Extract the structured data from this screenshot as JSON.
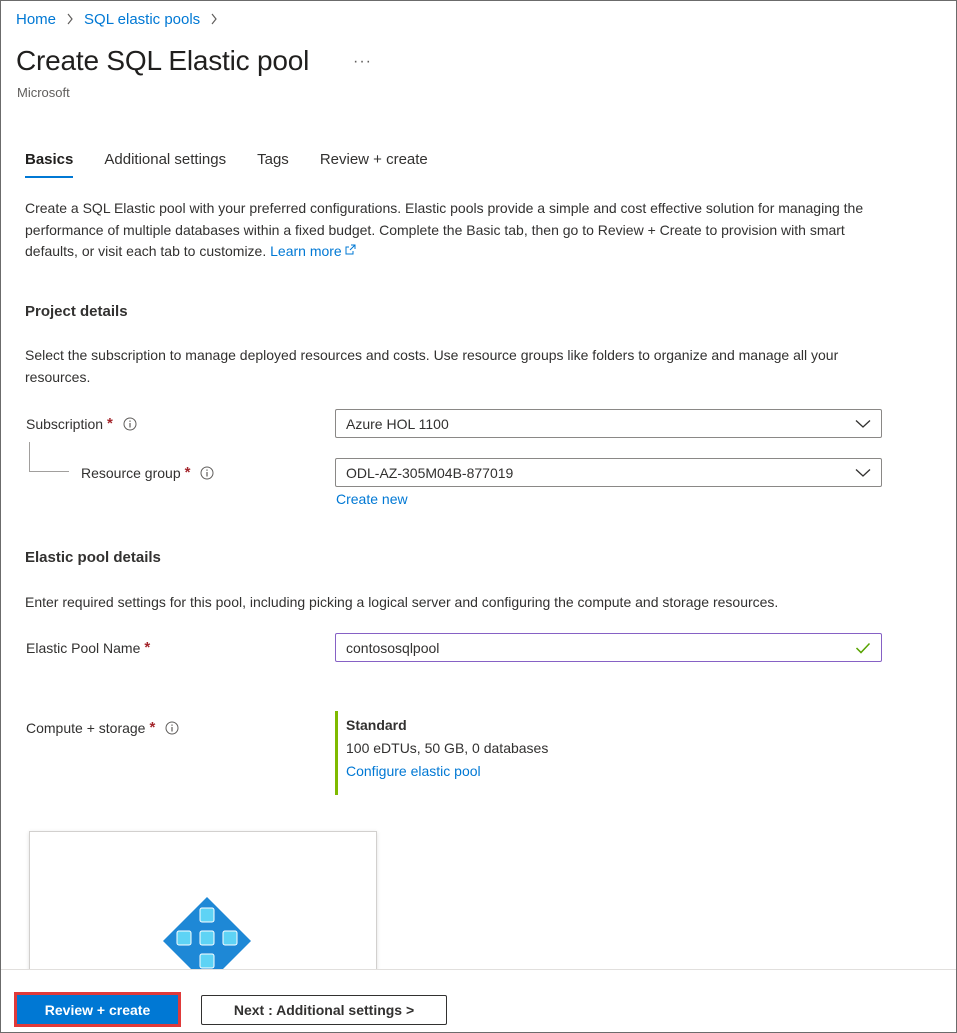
{
  "breadcrumb": {
    "items": [
      "Home",
      "SQL elastic pools"
    ]
  },
  "header": {
    "title": "Create SQL Elastic pool",
    "more": "···",
    "publisher": "Microsoft"
  },
  "tabs": [
    {
      "label": "Basics",
      "active": true
    },
    {
      "label": "Additional settings",
      "active": false
    },
    {
      "label": "Tags",
      "active": false
    },
    {
      "label": "Review + create",
      "active": false
    }
  ],
  "intro": {
    "text": "Create a SQL Elastic pool with your preferred configurations. Elastic pools provide a simple and cost effective solution for managing the performance of multiple databases within a fixed budget. Complete the Basic tab, then go to Review + Create to provision with smart defaults, or visit each tab to customize.",
    "learn_more": "Learn more"
  },
  "project": {
    "title": "Project details",
    "desc": "Select the subscription to manage deployed resources and costs. Use resource groups like folders to organize and manage all your resources.",
    "subscription_label": "Subscription",
    "subscription_value": "Azure HOL 1100",
    "resource_group_label": "Resource group",
    "resource_group_value": "ODL-AZ-305M04B-877019",
    "create_new": "Create new"
  },
  "pool": {
    "title": "Elastic pool details",
    "desc": "Enter required settings for this pool, including picking a logical server and configuring the compute and storage resources.",
    "name_label": "Elastic Pool Name",
    "name_value": "contososqlpool",
    "compute_label": "Compute + storage",
    "tier": "Standard",
    "tier_desc": "100 eDTUs, 50 GB, 0 databases",
    "configure_link": "Configure elastic pool"
  },
  "required_mark": "*",
  "footer": {
    "review_create": "Review + create",
    "next": "Next : Additional settings >"
  },
  "colors": {
    "accent": "#0078d4",
    "valid": "#7fba00",
    "required": "#a4262c",
    "highlight": "#e03a3a"
  }
}
